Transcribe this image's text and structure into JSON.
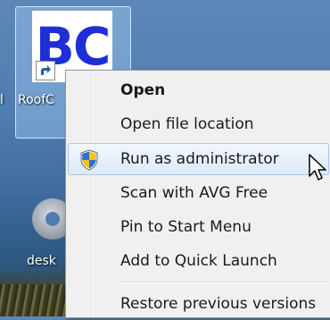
{
  "desktop": {
    "icon1": {
      "letters": "BC",
      "label": "RoofC",
      "label_left": "l"
    },
    "icon2": {
      "label": "desk"
    }
  },
  "context_menu": {
    "items": [
      {
        "label": "Open",
        "bold": true
      },
      {
        "label": "Open file location"
      },
      {
        "label": "Run as administrator",
        "icon": "uac-shield-icon",
        "highlighted": true
      },
      {
        "label": "Scan with AVG Free"
      },
      {
        "label": "Pin to Start Menu"
      },
      {
        "label": "Add to Quick Launch"
      },
      {
        "label": "Restore previous versions"
      }
    ]
  },
  "colors": {
    "accent_icon_text": "#1f2fd6",
    "menu_background": "#f0f0f0",
    "hover_border": "#a8c8ec"
  }
}
